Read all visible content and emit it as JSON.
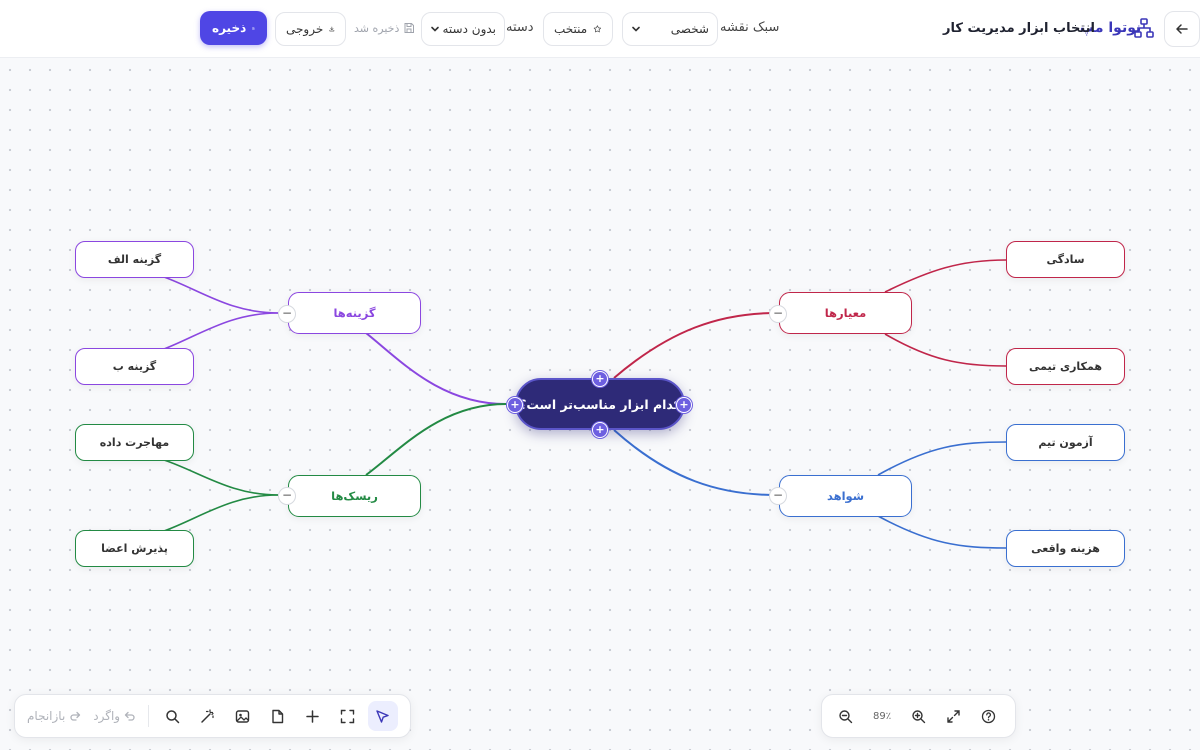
{
  "header": {
    "brand": "نوتوا مپ",
    "title": "انتخاب ابزار مدیریت کار",
    "map_style_label": "سبک نقشه",
    "map_style_value": "شخصی",
    "favorite_label": "منتخب",
    "category_label": "دسته",
    "category_value": "بدون دسته",
    "saved_status": "ذخیره شد",
    "export_label": "خروجی",
    "save_label": "ذخیره"
  },
  "mindmap": {
    "root": "کدام ابزار مناسب‌تر است؟",
    "branches": {
      "criteria": {
        "label": "معیارها",
        "color": "#c0264a",
        "children": [
          "سادگی",
          "همکاری تیمی"
        ]
      },
      "evidence": {
        "label": "شواهد",
        "color": "#3a6fd0",
        "children": [
          "آزمون تیم",
          "هزینه واقعی"
        ]
      },
      "options": {
        "label": "گزینه‌ها",
        "color": "#8b47e0",
        "children": [
          "گزینه الف",
          "گزینه ب"
        ]
      },
      "risks": {
        "label": "ریسک‌ها",
        "color": "#238a44",
        "children": [
          "مهاجرت داده",
          "پذیرش اعضا"
        ]
      }
    }
  },
  "bottom_toolbar": {
    "redo_label": "بازانجام",
    "undo_label": "واگرد"
  },
  "zoom_toolbar": {
    "zoom_value": "89٪"
  },
  "colors": {
    "accent": "#4f46e5",
    "root_bg": "#2e2a78"
  }
}
